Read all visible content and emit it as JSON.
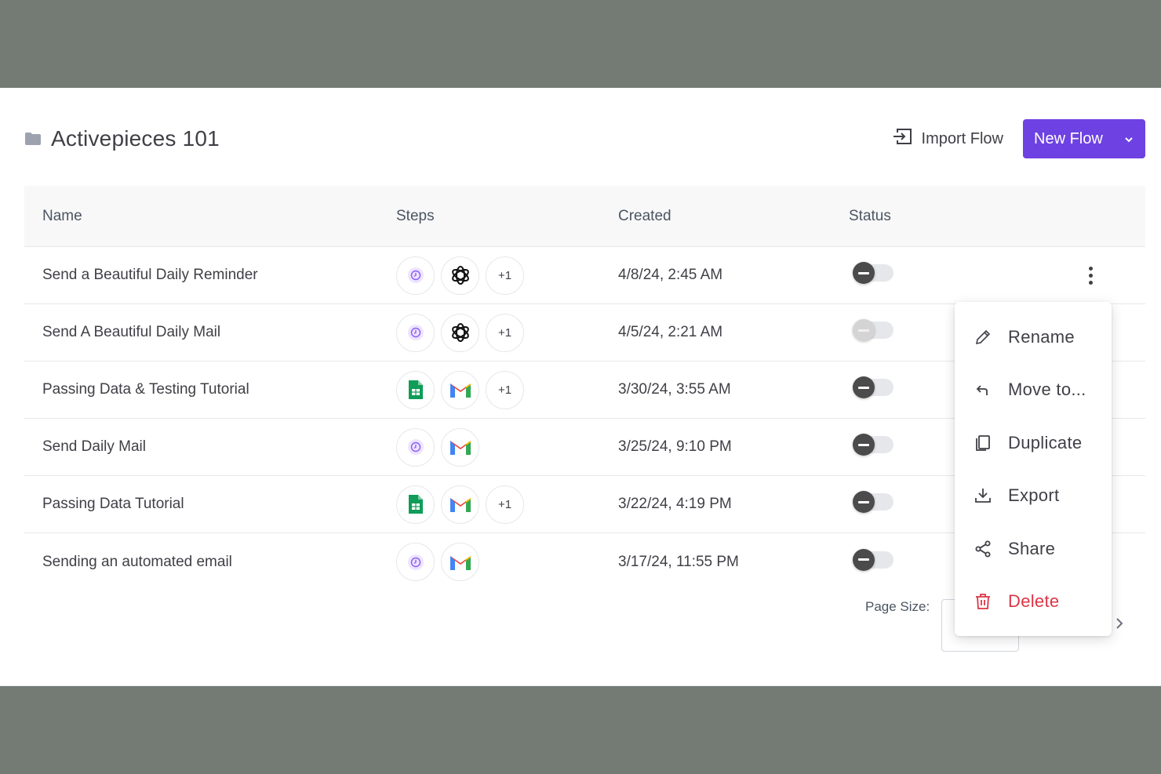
{
  "header": {
    "folder_name": "Activepieces 101",
    "import_label": "Import Flow",
    "new_flow_label": "New Flow"
  },
  "table": {
    "columns": [
      "Name",
      "Steps",
      "Created",
      "Status"
    ],
    "rows": [
      {
        "name": "Send a Beautiful Daily Reminder",
        "steps": [
          "schedule-icon",
          "openai-icon"
        ],
        "more": "+1",
        "created": "4/8/24, 2:45 AM",
        "enabled": true
      },
      {
        "name": "Send A Beautiful Daily Mail",
        "steps": [
          "schedule-icon",
          "openai-icon"
        ],
        "more": "+1",
        "created": "4/5/24, 2:21 AM",
        "enabled": false
      },
      {
        "name": "Passing Data & Testing Tutorial",
        "steps": [
          "google-sheets-icon",
          "gmail-icon"
        ],
        "more": "+1",
        "created": "3/30/24, 3:55 AM",
        "enabled": true
      },
      {
        "name": "Send Daily Mail",
        "steps": [
          "schedule-icon",
          "gmail-icon"
        ],
        "more": "",
        "created": "3/25/24, 9:10 PM",
        "enabled": true
      },
      {
        "name": "Passing Data Tutorial",
        "steps": [
          "google-sheets-icon",
          "gmail-icon"
        ],
        "more": "+1",
        "created": "3/22/24, 4:19 PM",
        "enabled": true
      },
      {
        "name": "Sending an automated email",
        "steps": [
          "schedule-icon",
          "gmail-icon"
        ],
        "more": "",
        "created": "3/17/24, 11:55 PM",
        "enabled": true
      }
    ]
  },
  "pagination": {
    "page_size_label": "Page Size:"
  },
  "context_menu": {
    "items": [
      {
        "label": "Rename",
        "icon": "pencil-icon"
      },
      {
        "label": "Move to...",
        "icon": "corner-up-left-icon"
      },
      {
        "label": "Duplicate",
        "icon": "copy-icon"
      },
      {
        "label": "Export",
        "icon": "download-icon"
      },
      {
        "label": "Share",
        "icon": "share-icon"
      },
      {
        "label": "Delete",
        "icon": "trash-icon"
      }
    ]
  },
  "colors": {
    "brand": "#6e41e2",
    "danger": "#dc3546",
    "backdrop": "#737b74"
  }
}
